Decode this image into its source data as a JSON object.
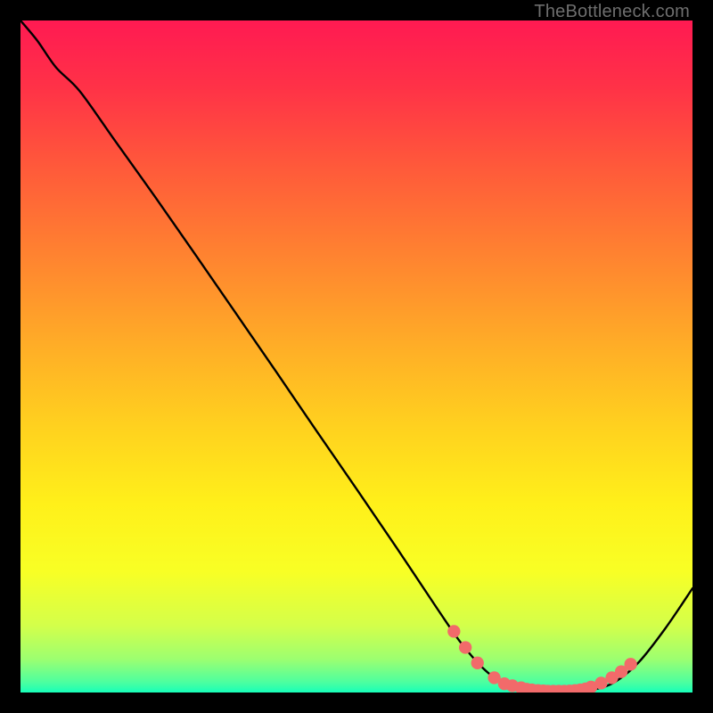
{
  "watermark": "TheBottleneck.com",
  "chart_data": {
    "type": "line",
    "title": "",
    "xlabel": "",
    "ylabel": "",
    "xlim": [
      0,
      100
    ],
    "ylim": [
      0,
      100
    ],
    "grid": false,
    "note": "Axes are unlabeled; x and y each run 0–100 in plot-relative units. The curve is read off pixel positions as percentages of the plot area.",
    "series": [
      {
        "name": "curve",
        "color": "#000000",
        "x": [
          0.0,
          2.5,
          5.3,
          8.8,
          14.0,
          20.0,
          26.0,
          32.0,
          38.0,
          44.0,
          50.0,
          56.0,
          62.0,
          66.0,
          70.0,
          74.0,
          78.0,
          82.0,
          85.5,
          88.5,
          92.0,
          96.0,
          100.0
        ],
        "y": [
          100.0,
          97.0,
          93.0,
          89.5,
          82.2,
          73.8,
          65.2,
          56.5,
          47.8,
          39.0,
          30.3,
          21.5,
          12.5,
          6.8,
          2.6,
          0.8,
          0.2,
          0.2,
          0.5,
          1.6,
          4.5,
          9.6,
          15.5
        ]
      }
    ],
    "markers": {
      "name": "valley-dots",
      "color": "#f26a6a",
      "radius_pct": 0.95,
      "x": [
        64.5,
        66.2,
        68.0,
        70.5,
        72.0,
        73.2,
        74.5,
        75.3,
        76.1,
        77.0,
        77.8,
        78.5,
        79.3,
        80.1,
        80.9,
        81.7,
        82.5,
        83.3,
        84.1,
        84.9,
        86.4,
        88.0,
        89.4,
        90.8
      ],
      "y": [
        9.1,
        6.7,
        4.4,
        2.2,
        1.3,
        1.0,
        0.7,
        0.5,
        0.4,
        0.3,
        0.25,
        0.2,
        0.2,
        0.2,
        0.2,
        0.23,
        0.3,
        0.4,
        0.55,
        0.8,
        1.4,
        2.2,
        3.1,
        4.2
      ]
    },
    "background_gradient": {
      "type": "vertical",
      "stops": [
        {
          "offset": 0.0,
          "color": "#ff1a52"
        },
        {
          "offset": 0.1,
          "color": "#ff3247"
        },
        {
          "offset": 0.22,
          "color": "#ff5a3a"
        },
        {
          "offset": 0.35,
          "color": "#ff8330"
        },
        {
          "offset": 0.48,
          "color": "#ffac27"
        },
        {
          "offset": 0.6,
          "color": "#ffd01f"
        },
        {
          "offset": 0.72,
          "color": "#fff01a"
        },
        {
          "offset": 0.82,
          "color": "#f8ff25"
        },
        {
          "offset": 0.9,
          "color": "#d4ff4a"
        },
        {
          "offset": 0.95,
          "color": "#9dff70"
        },
        {
          "offset": 0.985,
          "color": "#4cffa0"
        },
        {
          "offset": 1.0,
          "color": "#17ffb9"
        }
      ]
    }
  }
}
